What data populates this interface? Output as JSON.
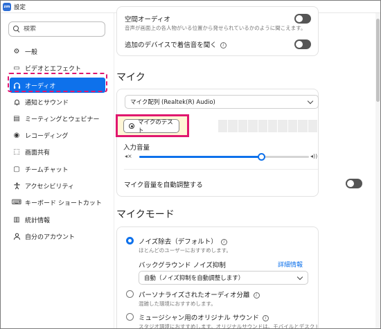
{
  "window": {
    "title": "設定",
    "logo_text": "zm"
  },
  "sidebar": {
    "search_placeholder": "検索",
    "items": [
      {
        "label": "一般",
        "icon": "gear-icon",
        "glyph": "⚙"
      },
      {
        "label": "ビデオとエフェクト",
        "icon": "video-camera-icon",
        "glyph": "▭"
      },
      {
        "label": "オーディオ",
        "icon": "headphones-icon",
        "glyph": "🎧"
      },
      {
        "label": "通知とサウンド",
        "icon": "bell-icon",
        "glyph": "🔔"
      },
      {
        "label": "ミーティングとウェビナー",
        "icon": "meeting-icon",
        "glyph": "▤"
      },
      {
        "label": "レコーディング",
        "icon": "record-icon",
        "glyph": "◉"
      },
      {
        "label": "画面共有",
        "icon": "screen-share-icon",
        "glyph": "⬚"
      },
      {
        "label": "チームチャット",
        "icon": "chat-icon",
        "glyph": "▢"
      },
      {
        "label": "アクセシビリティ",
        "icon": "accessibility-icon",
        "glyph": "♿"
      },
      {
        "label": "キーボード ショートカット",
        "icon": "keyboard-icon",
        "glyph": "⌨"
      },
      {
        "label": "統計情報",
        "icon": "stats-icon",
        "glyph": "▥"
      },
      {
        "label": "自分のアカウント",
        "icon": "account-icon",
        "glyph": "👤"
      }
    ],
    "active_index": 2
  },
  "audio_top": {
    "spatial_audio_title": "空間オーディオ",
    "spatial_audio_desc": "音声が画面上の各人物がいる位置から発せられているかのように聞こえます。",
    "ring_additional_label": "追加のデバイスで着信音を聞く"
  },
  "mic": {
    "section_title": "マイク",
    "device_value": "マイク配列 (Realtek(R) Audio)",
    "test_button_label": "マイクのテスト",
    "input_volume_label": "入力音量",
    "input_volume_level": 0.72,
    "auto_adjust_label": "マイク音量を自動調整する"
  },
  "mic_mode": {
    "section_title": "マイクモード",
    "options": [
      {
        "label": "ノイズ除去（デフォルト）",
        "desc": "ほとんどのユーザーにおすすめします。",
        "selected": true
      },
      {
        "label": "パーソナライズされたオーディオ分離",
        "desc": "混雑した環境におすすめします。",
        "selected": false
      },
      {
        "label": "ミュージシャン用のオリジナル サウンド",
        "desc": "スタジオ環境におすすめします。オリジナルサウンドは、モバイルとデスクトップのどちらのZoom Phone",
        "selected": false
      }
    ],
    "bg_noise_label": "バックグラウンド ノイズ抑制",
    "details_link": "詳細情報",
    "bg_noise_value": "自動（ノイズ抑制を自動調整します）"
  },
  "colors": {
    "accent": "#0e71eb",
    "highlight": "#e0176f"
  }
}
